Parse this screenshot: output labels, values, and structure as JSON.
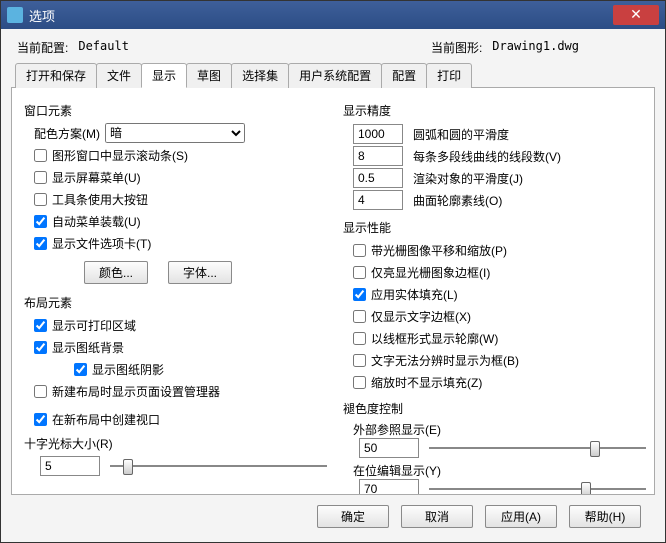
{
  "window": {
    "title": "选项"
  },
  "top": {
    "cfg_label": "当前配置:",
    "cfg_value": "Default",
    "drw_label": "当前图形:",
    "drw_value": "Drawing1.dwg"
  },
  "tabs": [
    "打开和保存",
    "文件",
    "显示",
    "草图",
    "选择集",
    "用户系统配置",
    "配置",
    "打印"
  ],
  "active_tab": "显示",
  "left": {
    "g1": "窗口元素",
    "scheme_label": "配色方案(M)",
    "scheme_value": "暗",
    "c1": "图形窗口中显示滚动条(S)",
    "c2": "显示屏幕菜单(U)",
    "c3": "工具条使用大按钮",
    "c4": "自动菜单装载(U)",
    "c5": "显示文件选项卡(T)",
    "btn_color": "颜色...",
    "btn_font": "字体...",
    "g2": "布局元素",
    "l1": "显示可打印区域",
    "l2": "显示图纸背景",
    "l2a": "显示图纸阴影",
    "l3": "新建布局时显示页面设置管理器",
    "l4": "在新布局中创建视口",
    "g3": "十字光标大小(R)",
    "cursor_value": "5"
  },
  "right": {
    "g1": "显示精度",
    "p1v": "1000",
    "p1l": "圆弧和圆的平滑度",
    "p2v": "8",
    "p2l": "每条多段线曲线的线段数(V)",
    "p3v": "0.5",
    "p3l": "渲染对象的平滑度(J)",
    "p4v": "4",
    "p4l": "曲面轮廓素线(O)",
    "g2": "显示性能",
    "d1": "带光栅图像平移和缩放(P)",
    "d2": "仅亮显光栅图象边框(I)",
    "d3": "应用实体填充(L)",
    "d4": "仅显示文字边框(X)",
    "d5": "以线框形式显示轮廓(W)",
    "d6": "文字无法分辨时显示为框(B)",
    "d7": "缩放时不显示填充(Z)",
    "g3": "褪色度控制",
    "f1l": "外部参照显示(E)",
    "f1v": "50",
    "f2l": "在位编辑显示(Y)",
    "f2v": "70"
  },
  "footer": {
    "ok": "确定",
    "cancel": "取消",
    "apply": "应用(A)",
    "help": "帮助(H)"
  }
}
